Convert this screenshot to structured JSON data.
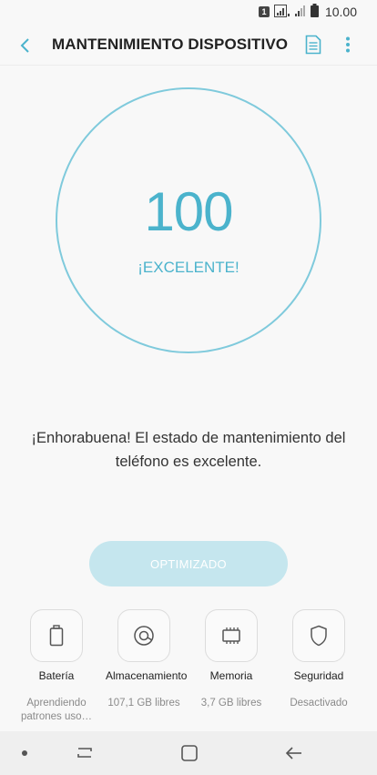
{
  "status_bar": {
    "sim": "1",
    "time": "10.00"
  },
  "header": {
    "title": "MANTENIMIENTO DISPOSITIVO"
  },
  "score": {
    "value": "100",
    "status": "¡EXCELENTE!"
  },
  "message": "¡Enhorabuena! El estado de mantenimiento del teléfono es excelente.",
  "optimize_button": "OPTIMIZADO",
  "categories": [
    {
      "label": "Batería",
      "sub": "Aprendiendo patrones uso…",
      "icon": "battery-icon"
    },
    {
      "label": "Almacenamiento",
      "sub": "107,1 GB libres",
      "icon": "storage-icon"
    },
    {
      "label": "Memoria",
      "sub": "3,7 GB libres",
      "icon": "memory-chip-icon"
    },
    {
      "label": "Seguridad",
      "sub": "Desactivado",
      "icon": "shield-icon"
    }
  ],
  "colors": {
    "accent": "#4bb3cc",
    "ring": "#7fcadc",
    "button_disabled": "#c5e6ee"
  }
}
